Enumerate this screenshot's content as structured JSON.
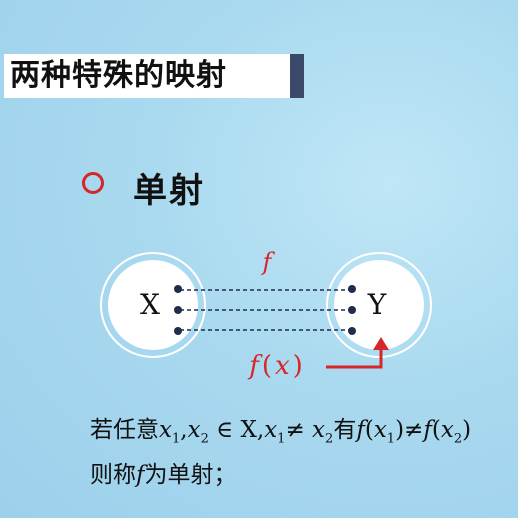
{
  "slide": {
    "title": "两种特殊的映射",
    "subtitle": "单射"
  },
  "diagram": {
    "domain_label": "X",
    "codomain_label": "Y",
    "map_label": "f",
    "image_label": "f(x)",
    "image_label_parts": [
      "f",
      "(",
      "x",
      ")"
    ]
  },
  "definition": {
    "prefix": "若任意",
    "cond_text": "x1,x2 ∈ X,x1≠ x2有f(x1)≠f(x2)",
    "conclusion_prefix": "则称",
    "conclusion_var": "f",
    "conclusion_suffix": "为单射；"
  },
  "colors": {
    "accent_red": "#d6262a",
    "title_accent": "#3b4a6b",
    "dot": "#1f2d4a"
  }
}
